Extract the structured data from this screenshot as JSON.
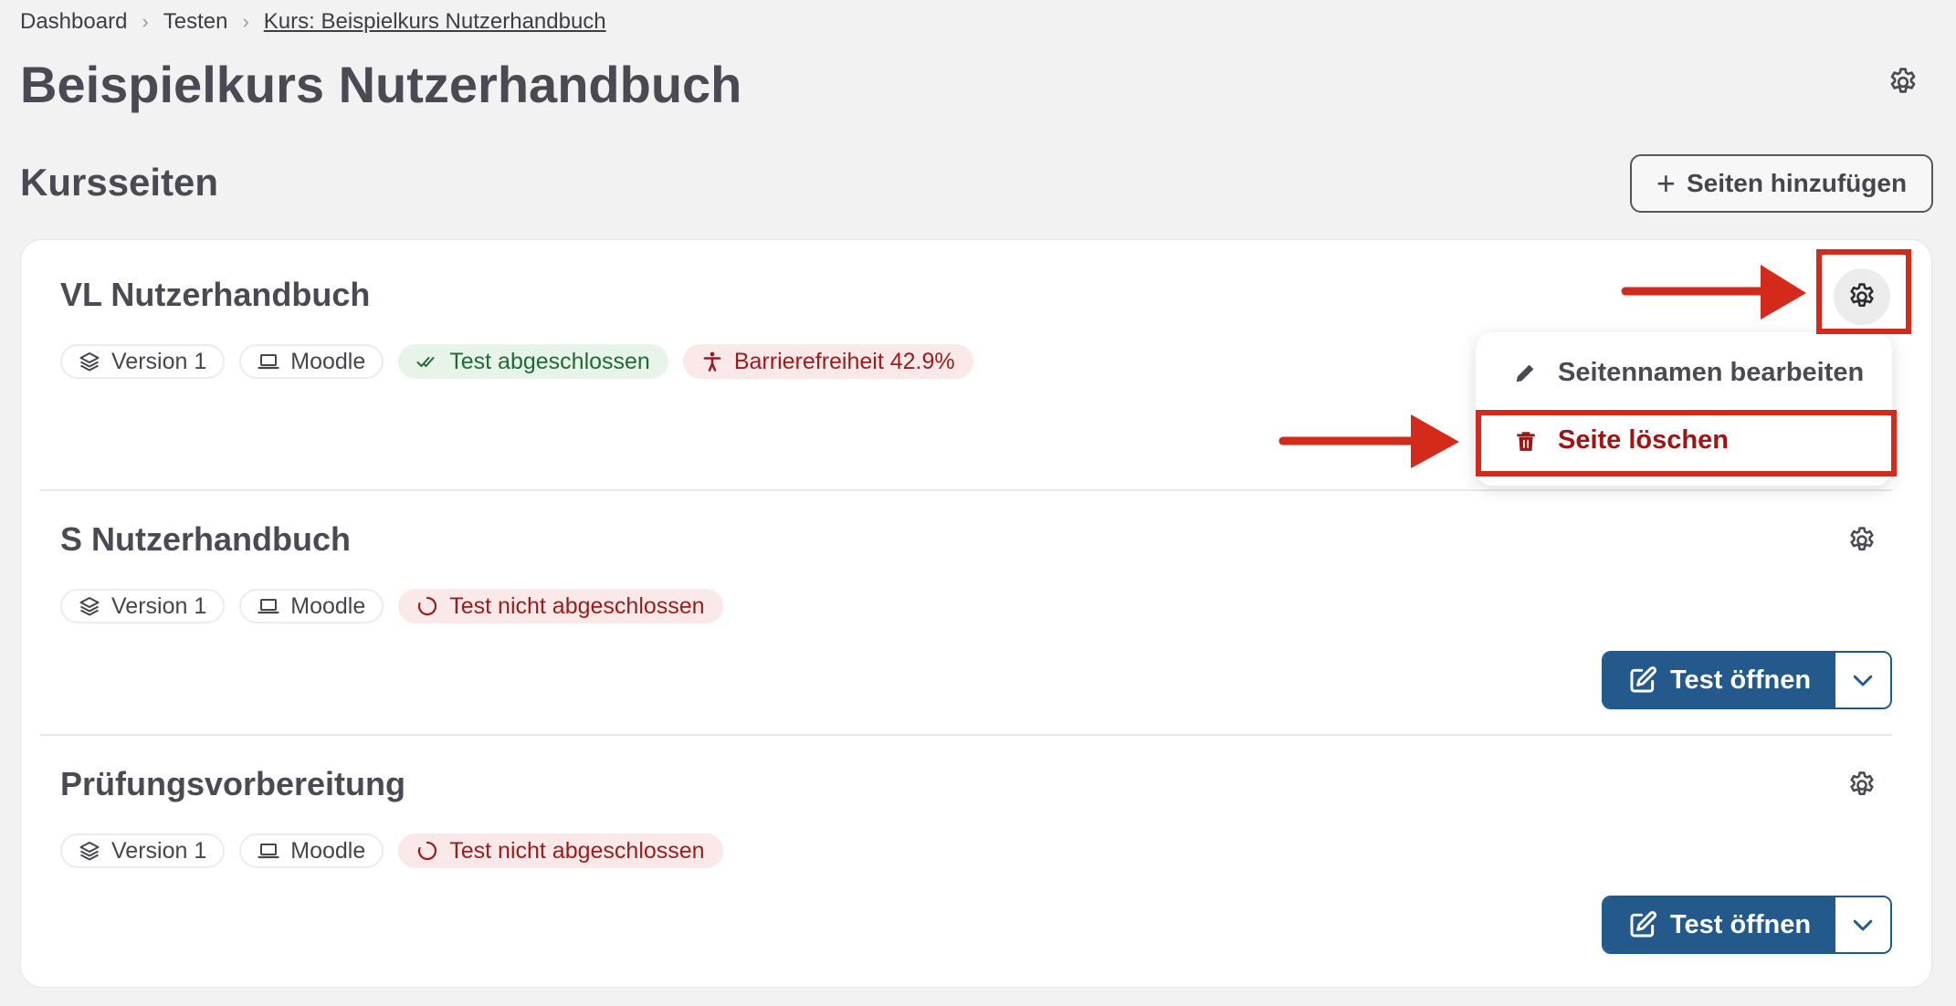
{
  "breadcrumb": {
    "items": [
      "Dashboard",
      "Testen"
    ],
    "current": "Kurs: Beispielkurs Nutzerhandbuch"
  },
  "page_title": "Beispielkurs Nutzerhandbuch",
  "section": {
    "title": "Kursseiten",
    "add_button": "Seiten hinzufügen"
  },
  "pages": [
    {
      "name": "VL Nutzerhandbuch",
      "version": "Version 1",
      "platform": "Moodle",
      "status": "Test abgeschlossen",
      "accessibility": "Barrierefreiheit 42.9%"
    },
    {
      "name": "S Nutzerhandbuch",
      "version": "Version 1",
      "platform": "Moodle",
      "status": "Test nicht abgeschlossen",
      "action": "Test öffnen"
    },
    {
      "name": "Prüfungsvorbereitung",
      "version": "Version 1",
      "platform": "Moodle",
      "status": "Test nicht abgeschlossen",
      "action": "Test öffnen"
    }
  ],
  "context_menu": {
    "edit": "Seitennamen bearbeiten",
    "delete": "Seite löschen"
  },
  "colors": {
    "primary": "#24598b",
    "success_bg": "#e8f3ea",
    "danger_bg": "#fbe9e9",
    "danger_text": "#a01414",
    "annotation": "#d42a1c"
  }
}
